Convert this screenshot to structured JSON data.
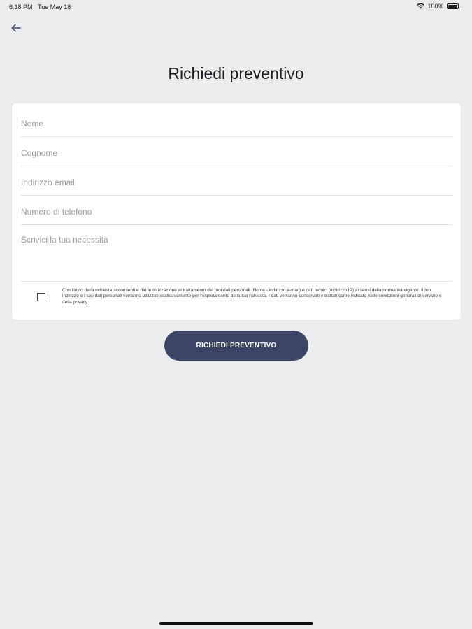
{
  "status_bar": {
    "time": "6:18 PM",
    "date": "Tue May 18",
    "battery_text": "100%",
    "battery_level": 1.0,
    "icons": [
      "wifi-icon",
      "battery-icon"
    ]
  },
  "header": {
    "back_icon": "arrow-left-icon",
    "title": "Richiedi preventivo"
  },
  "form": {
    "fields": {
      "nome": {
        "placeholder": "Nome",
        "value": ""
      },
      "cognome": {
        "placeholder": "Cognome",
        "value": ""
      },
      "email": {
        "placeholder": "Indirizzo email",
        "value": ""
      },
      "telefono": {
        "placeholder": "Numero di telefono",
        "value": ""
      },
      "necessita": {
        "placeholder": "Scrivici la tua necessità",
        "value": ""
      }
    },
    "consent": {
      "checked": false,
      "text": "Con l'invio della richiesta acconsenti e dai autorizzazione al trattamento dei tuoi dati personali (Nome - indirizzo e-mail) e dati tecnici (indirizzo IP) ai sensi della normativa vigente. Il tuo indirizzo e i tuoi dati personali verranno utilizzati esclusivamente per l'espletamento della tua richiesta. I dati verranno conservati e trattati come indicato nelle condizioni generali di servizio e della privacy"
    },
    "submit_label": "RICHIEDI PREVENTIVO"
  },
  "colors": {
    "background": "#ebecee",
    "card": "#ffffff",
    "button": "#3c4566",
    "text": "#1d1d22",
    "placeholder": "#9a9aa2"
  }
}
